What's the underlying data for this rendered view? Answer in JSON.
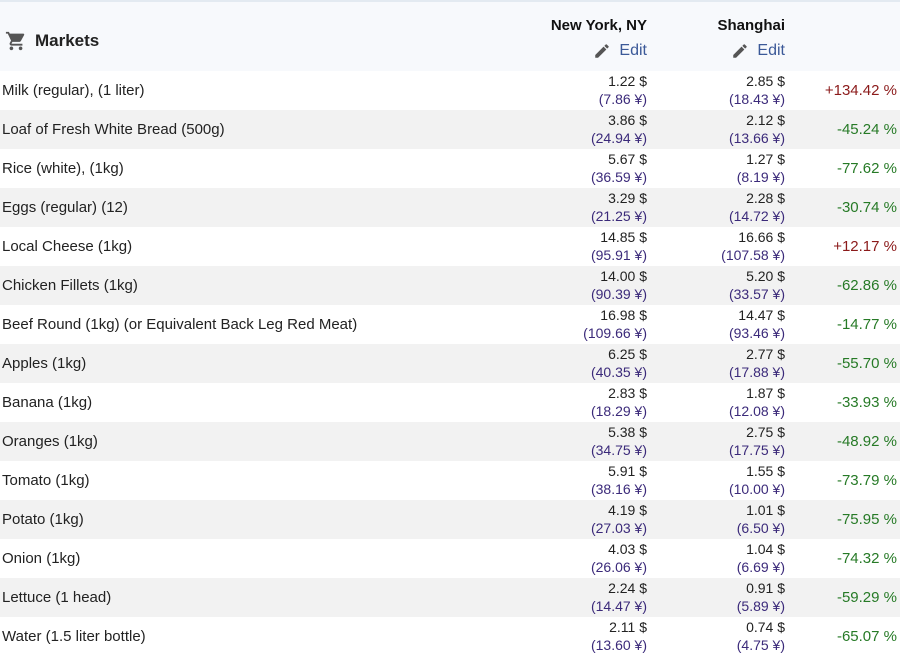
{
  "header": {
    "title": "Markets",
    "city1": "New York, NY",
    "city2": "Shanghai",
    "edit_label": "Edit"
  },
  "colors": {
    "positive": "#8b1a1a",
    "negative": "#267a26",
    "cny": "#3b2a7a",
    "link": "#3b5998",
    "header_bg": "#f7f9fc",
    "row_alt_bg": "#f2f2f2"
  },
  "icons": {
    "markets": "shopping-cart-icon",
    "edit": "pencil-icon"
  },
  "rows": [
    {
      "item": "Milk (regular), (1 liter)",
      "ny_usd": "1.22 $",
      "ny_cny": "(7.86 ¥)",
      "sh_usd": "2.85 $",
      "sh_cny": "(18.43 ¥)",
      "diff": "+134.42 %"
    },
    {
      "item": "Loaf of Fresh White Bread (500g)",
      "ny_usd": "3.86 $",
      "ny_cny": "(24.94 ¥)",
      "sh_usd": "2.12 $",
      "sh_cny": "(13.66 ¥)",
      "diff": "-45.24 %"
    },
    {
      "item": "Rice (white), (1kg)",
      "ny_usd": "5.67 $",
      "ny_cny": "(36.59 ¥)",
      "sh_usd": "1.27 $",
      "sh_cny": "(8.19 ¥)",
      "diff": "-77.62 %"
    },
    {
      "item": "Eggs (regular) (12)",
      "ny_usd": "3.29 $",
      "ny_cny": "(21.25 ¥)",
      "sh_usd": "2.28 $",
      "sh_cny": "(14.72 ¥)",
      "diff": "-30.74 %"
    },
    {
      "item": "Local Cheese (1kg)",
      "ny_usd": "14.85 $",
      "ny_cny": "(95.91 ¥)",
      "sh_usd": "16.66 $",
      "sh_cny": "(107.58 ¥)",
      "diff": "+12.17 %"
    },
    {
      "item": "Chicken Fillets (1kg)",
      "ny_usd": "14.00 $",
      "ny_cny": "(90.39 ¥)",
      "sh_usd": "5.20 $",
      "sh_cny": "(33.57 ¥)",
      "diff": "-62.86 %"
    },
    {
      "item": "Beef Round (1kg) (or Equivalent Back Leg Red Meat)",
      "ny_usd": "16.98 $",
      "ny_cny": "(109.66 ¥)",
      "sh_usd": "14.47 $",
      "sh_cny": "(93.46 ¥)",
      "diff": "-14.77 %"
    },
    {
      "item": "Apples (1kg)",
      "ny_usd": "6.25 $",
      "ny_cny": "(40.35 ¥)",
      "sh_usd": "2.77 $",
      "sh_cny": "(17.88 ¥)",
      "diff": "-55.70 %"
    },
    {
      "item": "Banana (1kg)",
      "ny_usd": "2.83 $",
      "ny_cny": "(18.29 ¥)",
      "sh_usd": "1.87 $",
      "sh_cny": "(12.08 ¥)",
      "diff": "-33.93 %"
    },
    {
      "item": "Oranges (1kg)",
      "ny_usd": "5.38 $",
      "ny_cny": "(34.75 ¥)",
      "sh_usd": "2.75 $",
      "sh_cny": "(17.75 ¥)",
      "diff": "-48.92 %"
    },
    {
      "item": "Tomato (1kg)",
      "ny_usd": "5.91 $",
      "ny_cny": "(38.16 ¥)",
      "sh_usd": "1.55 $",
      "sh_cny": "(10.00 ¥)",
      "diff": "-73.79 %"
    },
    {
      "item": "Potato (1kg)",
      "ny_usd": "4.19 $",
      "ny_cny": "(27.03 ¥)",
      "sh_usd": "1.01 $",
      "sh_cny": "(6.50 ¥)",
      "diff": "-75.95 %"
    },
    {
      "item": "Onion (1kg)",
      "ny_usd": "4.03 $",
      "ny_cny": "(26.06 ¥)",
      "sh_usd": "1.04 $",
      "sh_cny": "(6.69 ¥)",
      "diff": "-74.32 %"
    },
    {
      "item": "Lettuce (1 head)",
      "ny_usd": "2.24 $",
      "ny_cny": "(14.47 ¥)",
      "sh_usd": "0.91 $",
      "sh_cny": "(5.89 ¥)",
      "diff": "-59.29 %"
    },
    {
      "item": "Water (1.5 liter bottle)",
      "ny_usd": "2.11 $",
      "ny_cny": "(13.60 ¥)",
      "sh_usd": "0.74 $",
      "sh_cny": "(4.75 ¥)",
      "diff": "-65.07 %"
    }
  ]
}
